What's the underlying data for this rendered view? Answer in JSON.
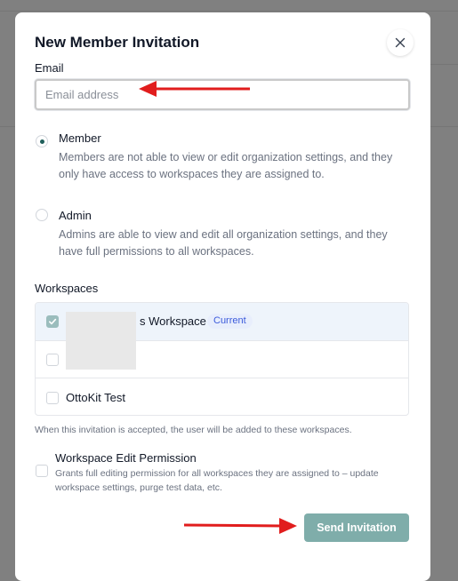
{
  "modal": {
    "title": "New Member Invitation",
    "close_icon": "close-icon"
  },
  "email": {
    "label": "Email",
    "placeholder": "Email address",
    "value": ""
  },
  "roles": [
    {
      "title": "Member",
      "description": "Members are not able to view or edit organization settings, and they only have access to workspaces they are assigned to.",
      "selected": true
    },
    {
      "title": "Admin",
      "description": "Admins are able to view and edit all organization settings, and they have full permissions to all workspaces.",
      "selected": false
    }
  ],
  "workspaces": {
    "label": "Workspaces",
    "items": [
      {
        "name": "s Workspace",
        "badge": "Current",
        "checked": true
      },
      {
        "name": "",
        "checked": false
      },
      {
        "name": "OttoKit Test",
        "checked": false
      }
    ],
    "hint": "When this invitation is accepted, the user will be added to these workspaces."
  },
  "permission": {
    "title": "Workspace Edit Permission",
    "description": "Grants full editing permission for all workspaces they are assigned to – update workspace settings, purge test data, etc.",
    "checked": false
  },
  "actions": {
    "send_label": "Send Invitation"
  },
  "colors": {
    "accent": "#7fadaa",
    "radio_selected": "#1f5f5b",
    "badge_text": "#3b5bdb",
    "annotation_arrow": "#e11d1d"
  }
}
